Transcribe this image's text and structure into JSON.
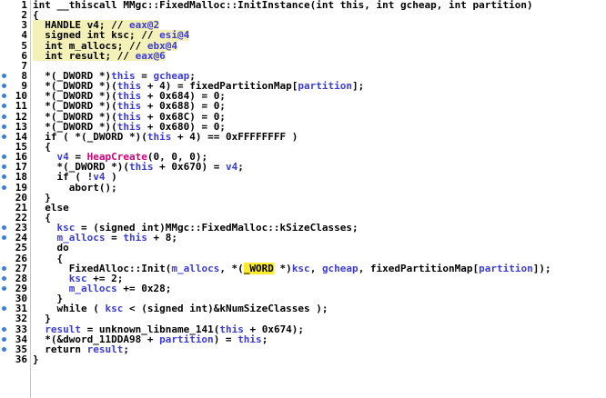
{
  "colors": {
    "keyword": "#000000",
    "variable": "#3b3bdc",
    "number": "#0a7a0a",
    "import_function": "#d2007a",
    "declaration_background": "#f3f1b8",
    "highlight_background": "#ffeb2c",
    "breakpoint_dot": "#3d7fd0"
  },
  "lines": [
    {
      "num": "1",
      "dot": false,
      "bg": "",
      "tokens": [
        [
          "",
          "int __thiscall MMgc::FixedMalloc::InitInstance(int this, int gcheap, int partition)"
        ]
      ]
    },
    {
      "num": "2",
      "dot": false,
      "bg": "",
      "tokens": [
        [
          "",
          "{"
        ]
      ]
    },
    {
      "num": "3",
      "dot": false,
      "bg": "decl",
      "tokens": [
        [
          "",
          "  HANDLE v4; // "
        ],
        [
          "var",
          "eax@2"
        ]
      ]
    },
    {
      "num": "4",
      "dot": false,
      "bg": "decl",
      "tokens": [
        [
          "",
          "  signed int ksc; // "
        ],
        [
          "var",
          "esi@4"
        ]
      ]
    },
    {
      "num": "5",
      "dot": false,
      "bg": "decl",
      "tokens": [
        [
          "",
          "  int m_allocs; // "
        ],
        [
          "var",
          "ebx@4"
        ]
      ]
    },
    {
      "num": "6",
      "dot": false,
      "bg": "decl",
      "tokens": [
        [
          "",
          "  int result; // "
        ],
        [
          "var",
          "eax@6"
        ]
      ]
    },
    {
      "num": "7",
      "dot": false,
      "bg": "",
      "tokens": [
        [
          "",
          ""
        ]
      ]
    },
    {
      "num": "8",
      "dot": true,
      "bg": "",
      "tokens": [
        [
          "",
          "  *(_DWORD *)"
        ],
        [
          "var",
          "this"
        ],
        [
          "",
          " = "
        ],
        [
          "var",
          "gcheap"
        ],
        [
          "",
          ";"
        ]
      ]
    },
    {
      "num": "9",
      "dot": true,
      "bg": "",
      "tokens": [
        [
          "",
          "  *(_DWORD *)("
        ],
        [
          "var",
          "this"
        ],
        [
          "",
          " + 4) = fixedPartitionMap["
        ],
        [
          "var",
          "partition"
        ],
        [
          "",
          "];"
        ]
      ]
    },
    {
      "num": "10",
      "dot": true,
      "bg": "",
      "tokens": [
        [
          "",
          "  *(_DWORD *)("
        ],
        [
          "var",
          "this"
        ],
        [
          "",
          " + 0x684) = 0;"
        ]
      ]
    },
    {
      "num": "11",
      "dot": true,
      "bg": "",
      "tokens": [
        [
          "",
          "  *(_DWORD *)("
        ],
        [
          "var",
          "this"
        ],
        [
          "",
          " + 0x688) = 0;"
        ]
      ]
    },
    {
      "num": "12",
      "dot": true,
      "bg": "",
      "tokens": [
        [
          "",
          "  *(_DWORD *)("
        ],
        [
          "var",
          "this"
        ],
        [
          "",
          " + 0x68C) = 0;"
        ]
      ]
    },
    {
      "num": "13",
      "dot": true,
      "bg": "",
      "tokens": [
        [
          "",
          "  *(_DWORD *)("
        ],
        [
          "var",
          "this"
        ],
        [
          "",
          " + 0x680) = 0;"
        ]
      ]
    },
    {
      "num": "14",
      "dot": true,
      "bg": "",
      "tokens": [
        [
          "",
          "  if ( *(_DWORD *)("
        ],
        [
          "var",
          "this"
        ],
        [
          "",
          " + 4) == 0xFFFFFFFF )"
        ]
      ]
    },
    {
      "num": "15",
      "dot": false,
      "bg": "",
      "tokens": [
        [
          "",
          "  {"
        ]
      ]
    },
    {
      "num": "16",
      "dot": true,
      "bg": "",
      "tokens": [
        [
          "",
          "    "
        ],
        [
          "var",
          "v4"
        ],
        [
          "",
          " = "
        ],
        [
          "fn",
          "HeapCreate"
        ],
        [
          "",
          "(0, 0, 0);"
        ]
      ]
    },
    {
      "num": "17",
      "dot": true,
      "bg": "",
      "tokens": [
        [
          "",
          "    *(_DWORD *)("
        ],
        [
          "var",
          "this"
        ],
        [
          "",
          " + 0x670) = "
        ],
        [
          "var",
          "v4"
        ],
        [
          "",
          ";"
        ]
      ]
    },
    {
      "num": "18",
      "dot": true,
      "bg": "",
      "tokens": [
        [
          "",
          "    if ( !"
        ],
        [
          "var",
          "v4"
        ],
        [
          "",
          " )"
        ]
      ]
    },
    {
      "num": "19",
      "dot": true,
      "bg": "",
      "tokens": [
        [
          "",
          "      abort();"
        ]
      ]
    },
    {
      "num": "20",
      "dot": false,
      "bg": "",
      "tokens": [
        [
          "",
          "  }"
        ]
      ]
    },
    {
      "num": "21",
      "dot": false,
      "bg": "",
      "tokens": [
        [
          "",
          "  else"
        ]
      ]
    },
    {
      "num": "22",
      "dot": false,
      "bg": "",
      "tokens": [
        [
          "",
          "  {"
        ]
      ]
    },
    {
      "num": "23",
      "dot": true,
      "bg": "",
      "tokens": [
        [
          "",
          "    "
        ],
        [
          "var",
          "ksc"
        ],
        [
          "",
          " = (signed int)"
        ],
        [
          "blk",
          "MMgc::FixedMalloc::kSizeClasses"
        ],
        [
          "",
          ";"
        ]
      ]
    },
    {
      "num": "24",
      "dot": true,
      "bg": "",
      "tokens": [
        [
          "",
          "    "
        ],
        [
          "var",
          "m_allocs"
        ],
        [
          "",
          " = "
        ],
        [
          "var",
          "this"
        ],
        [
          "",
          " + 8;"
        ]
      ]
    },
    {
      "num": "25",
      "dot": false,
      "bg": "",
      "tokens": [
        [
          "",
          "    do"
        ]
      ]
    },
    {
      "num": "26",
      "dot": false,
      "bg": "",
      "tokens": [
        [
          "",
          "    {"
        ]
      ]
    },
    {
      "num": "27",
      "dot": true,
      "bg": "",
      "tokens": [
        [
          "",
          "      FixedAlloc::Init("
        ],
        [
          "var",
          "m_allocs"
        ],
        [
          "",
          ", *("
        ],
        [
          "cur",
          "_WORD"
        ],
        [
          "",
          " *)"
        ],
        [
          "var",
          "ksc"
        ],
        [
          "",
          ", "
        ],
        [
          "var",
          "gcheap"
        ],
        [
          "",
          ", fixedPartitionMap["
        ],
        [
          "var",
          "partition"
        ],
        [
          "",
          "]);"
        ]
      ]
    },
    {
      "num": "28",
      "dot": true,
      "bg": "",
      "tokens": [
        [
          "",
          "      "
        ],
        [
          "var",
          "ksc"
        ],
        [
          "",
          " += 2;"
        ]
      ]
    },
    {
      "num": "29",
      "dot": true,
      "bg": "",
      "tokens": [
        [
          "",
          "      "
        ],
        [
          "var",
          "m_allocs"
        ],
        [
          "",
          " += 0x28;"
        ]
      ]
    },
    {
      "num": "30",
      "dot": false,
      "bg": "",
      "tokens": [
        [
          "",
          "    }"
        ]
      ]
    },
    {
      "num": "31",
      "dot": true,
      "bg": "",
      "tokens": [
        [
          "",
          "    while ( "
        ],
        [
          "var",
          "ksc"
        ],
        [
          "",
          " < (signed int)&kNumSizeClasses );"
        ]
      ]
    },
    {
      "num": "32",
      "dot": false,
      "bg": "",
      "tokens": [
        [
          "",
          "  }"
        ]
      ]
    },
    {
      "num": "33",
      "dot": true,
      "bg": "",
      "tokens": [
        [
          "",
          "  "
        ],
        [
          "var",
          "result"
        ],
        [
          "",
          " = unknown_libname_141("
        ],
        [
          "var",
          "this"
        ],
        [
          "",
          " + 0x674);"
        ]
      ]
    },
    {
      "num": "34",
      "dot": true,
      "bg": "",
      "tokens": [
        [
          "",
          "  *(&dword_11DDA98 + "
        ],
        [
          "var",
          "partition"
        ],
        [
          "",
          ") = "
        ],
        [
          "var",
          "this"
        ],
        [
          "",
          ";"
        ]
      ]
    },
    {
      "num": "35",
      "dot": true,
      "bg": "",
      "tokens": [
        [
          "",
          "  return "
        ],
        [
          "var",
          "result"
        ],
        [
          "",
          ";"
        ]
      ]
    },
    {
      "num": "36",
      "dot": false,
      "bg": "",
      "tokens": [
        [
          "",
          "}"
        ]
      ]
    }
  ]
}
